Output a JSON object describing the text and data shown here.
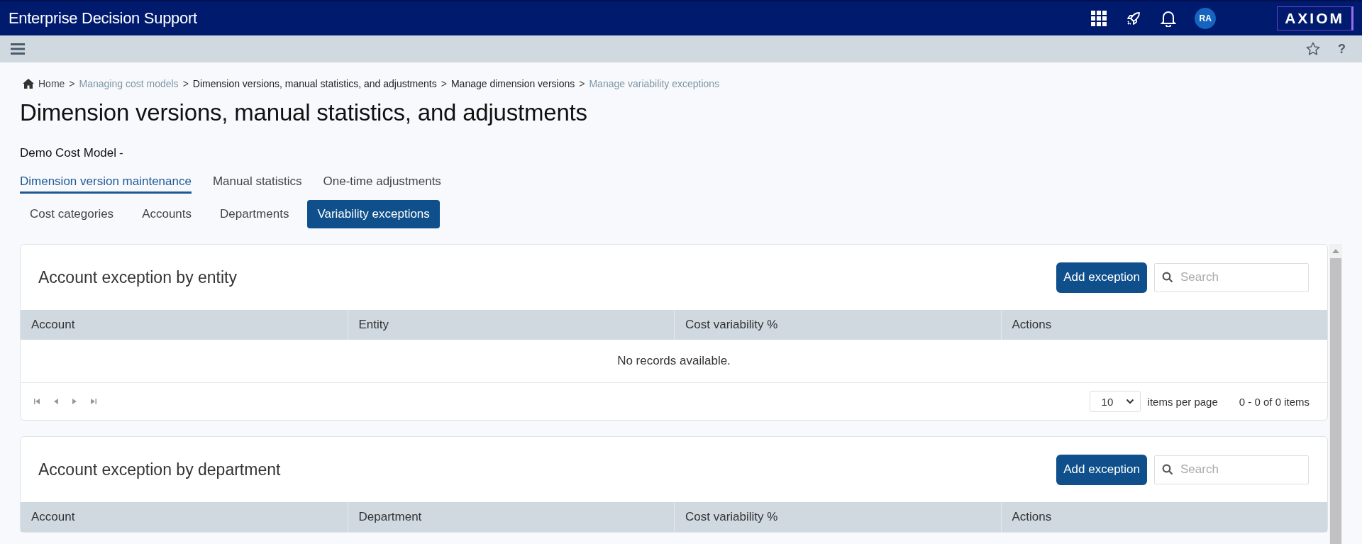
{
  "app_bar": {
    "title": "Enterprise Decision Support",
    "avatar": "RA",
    "logo": "AXIOM"
  },
  "toolbar": {
    "help": "?"
  },
  "breadcrumb": [
    {
      "kind": "home",
      "text": "Home"
    },
    {
      "kind": "separator",
      "text": ">"
    },
    {
      "kind": "link",
      "text": "Managing cost models"
    },
    {
      "kind": "separator",
      "text": ">"
    },
    {
      "kind": "plain",
      "text": "Dimension versions, manual statistics, and adjustments"
    },
    {
      "kind": "separator",
      "text": ">"
    },
    {
      "kind": "plain",
      "text": "Manage dimension versions"
    },
    {
      "kind": "separator",
      "text": ">"
    },
    {
      "kind": "current",
      "text": "Manage variability exceptions"
    }
  ],
  "page_title": "Dimension versions, manual statistics, and adjustments",
  "model": {
    "name": "Demo Cost Model",
    "suffix": "-"
  },
  "tabs": [
    {
      "label": "Dimension version maintenance",
      "selected": true
    },
    {
      "label": "Manual statistics",
      "selected": false
    },
    {
      "label": "One-time adjustments",
      "selected": false
    }
  ],
  "subtabs": [
    {
      "label": "Cost categories",
      "selected": false
    },
    {
      "label": "Accounts",
      "selected": false
    },
    {
      "label": "Departments",
      "selected": false
    },
    {
      "label": "Variability exceptions",
      "selected": true
    }
  ],
  "panels": [
    {
      "title": "Account exception by entity",
      "add_button": "Add exception",
      "search": {
        "placeholder": "Search"
      },
      "columns": [
        "Account",
        "Entity",
        "Cost variability %",
        "Actions"
      ],
      "empty_message": "No records available.",
      "pager": {
        "page_size": "10",
        "page_size_label": "items per page",
        "summary": "0 - 0 of 0 items"
      }
    },
    {
      "title": "Account exception by department",
      "add_button": "Add exception",
      "search": {
        "placeholder": "Search"
      },
      "columns": [
        "Account",
        "Department",
        "Cost variability %",
        "Actions"
      ]
    }
  ]
}
